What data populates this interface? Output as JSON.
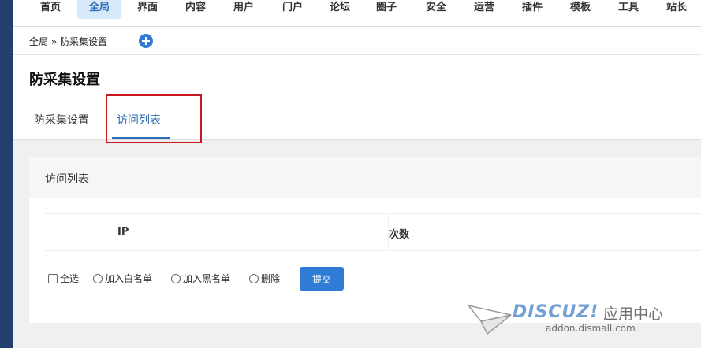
{
  "topnav": {
    "items": [
      "首页",
      "全局",
      "界面",
      "内容",
      "用户",
      "门户",
      "论坛",
      "圈子",
      "安全",
      "运营",
      "插件",
      "模板",
      "工具",
      "站长"
    ],
    "active_index": 1
  },
  "breadcrumb": {
    "text": "全局 » 防采集设置"
  },
  "header": {
    "title": "防采集设置",
    "tabs": [
      "防采集设置",
      "访问列表"
    ],
    "active_tab": 1
  },
  "panel": {
    "title": "访问列表",
    "columns": [
      "IP",
      "次数"
    ],
    "options": [
      "全选",
      "加入白名单",
      "加入黑名单",
      "删除"
    ],
    "submit_label": "提交"
  },
  "watermark": {
    "brand": "DISCUZ!",
    "suffix": "应用中心",
    "url": "addon.dismall.com"
  },
  "colors": {
    "sidebar": "#21406d",
    "accent": "#2f7bd6",
    "active_nav_bg": "#d7e9fb",
    "highlight": "#c8161d"
  }
}
